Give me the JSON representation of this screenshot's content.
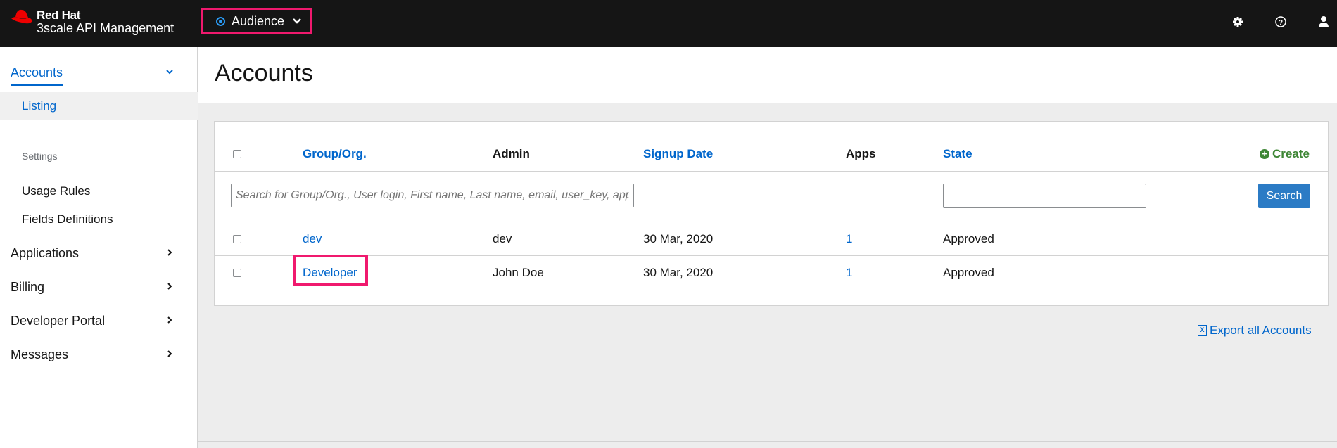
{
  "brand": {
    "line1": "Red Hat",
    "line2": "3scale API Management"
  },
  "context_selector": {
    "label": "Audience",
    "icon": "target-icon",
    "dropdown_icon": "chevron-down-icon"
  },
  "top_icons": [
    "gear-icon",
    "help-icon",
    "user-icon"
  ],
  "sidebar": {
    "accounts": "Accounts",
    "listing": "Listing",
    "settings_heading": "Settings",
    "usage_rules": "Usage Rules",
    "fields_definitions": "Fields Definitions",
    "applications": "Applications",
    "billing": "Billing",
    "developer_portal": "Developer Portal",
    "messages": "Messages"
  },
  "page": {
    "title": "Accounts"
  },
  "table": {
    "headers": {
      "group": "Group/Org.",
      "admin": "Admin",
      "signup": "Signup Date",
      "apps": "Apps",
      "state": "State"
    },
    "create_label": "Create",
    "search_placeholder": "Search for Group/Org., User login, First name, Last name, email, user_key, app_id or",
    "search_button": "Search",
    "rows": [
      {
        "group": "dev",
        "admin": "dev",
        "signup": "30 Mar, 2020",
        "apps": "1",
        "state": "Approved"
      },
      {
        "group": "Developer",
        "admin": "John Doe",
        "signup": "30 Mar, 2020",
        "apps": "1",
        "state": "Approved"
      }
    ]
  },
  "export_label": "Export all Accounts",
  "colors": {
    "topbar": "#151515",
    "link": "#0066cc",
    "highlight": "#f0196e",
    "create": "#3e8635",
    "button": "#2b7bc5"
  }
}
